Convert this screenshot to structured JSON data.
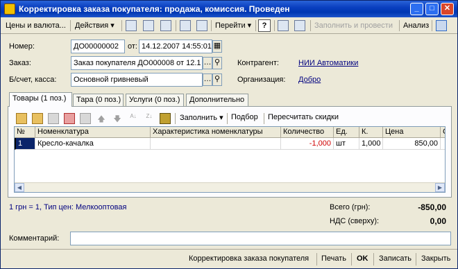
{
  "window": {
    "title": "Корректировка заказа покупателя: продажа, комиссия. Проведен",
    "min_glyph": "_",
    "max_glyph": "□",
    "close_glyph": "✕"
  },
  "toolbar": {
    "prices_currency": "Цены и валюта...",
    "actions": "Действия",
    "goto": "Перейти",
    "help": "?",
    "fill_and_post": "Заполнить и провести",
    "analysis": "Анализ"
  },
  "form": {
    "number_label": "Номер:",
    "number_value": "ДО00000002",
    "from_label": "от:",
    "date_value": "14.12.2007 14:55:01",
    "order_label": "Заказ:",
    "order_value": "Заказ покупателя ДО000008 от 12.1",
    "account_label": "Б/счет, касса:",
    "account_value": "Основной гривневый",
    "counterparty_label": "Контрагент:",
    "counterparty_value": "НИИ Автоматики",
    "organization_label": "Организация:",
    "organization_value": "Добро"
  },
  "tabs": [
    {
      "label": "Товары (1 поз.)"
    },
    {
      "label": "Тара (0 поз.)"
    },
    {
      "label": "Услуги (0 поз.)"
    },
    {
      "label": "Дополнительно"
    }
  ],
  "table_toolbar": {
    "fill": "Заполнить",
    "pick": "Подбор",
    "recalc_discounts": "Пересчитать скидки"
  },
  "table": {
    "columns": [
      "№",
      "Номенклатура",
      "Характеристика номенклатуры",
      "Количество",
      "Ед.",
      "К.",
      "Цена",
      "С"
    ],
    "rows": [
      {
        "n": "1",
        "item": "Кресло-качалка",
        "characteristic": "",
        "qty": "-1,000",
        "unit": "шт",
        "k": "1,000",
        "price": "850,00"
      }
    ]
  },
  "summary": {
    "rate_info": "1 грн = 1, Тип цен: Мелкооптовая",
    "total_label": "Всего (грн):",
    "total_value": "-850,00",
    "vat_label": "НДС (сверху):",
    "vat_value": "0,00"
  },
  "comment": {
    "label": "Комментарий:",
    "value": ""
  },
  "footer": {
    "order_correction": "Корректировка заказа покупателя",
    "print": "Печать",
    "ok": "OK",
    "save": "Записать",
    "close": "Закрыть"
  },
  "colors": {
    "titlebar": "#0a3fbf",
    "negative_qty": "#d00000",
    "link": "#00007f",
    "row_marker": "#0a246a"
  }
}
